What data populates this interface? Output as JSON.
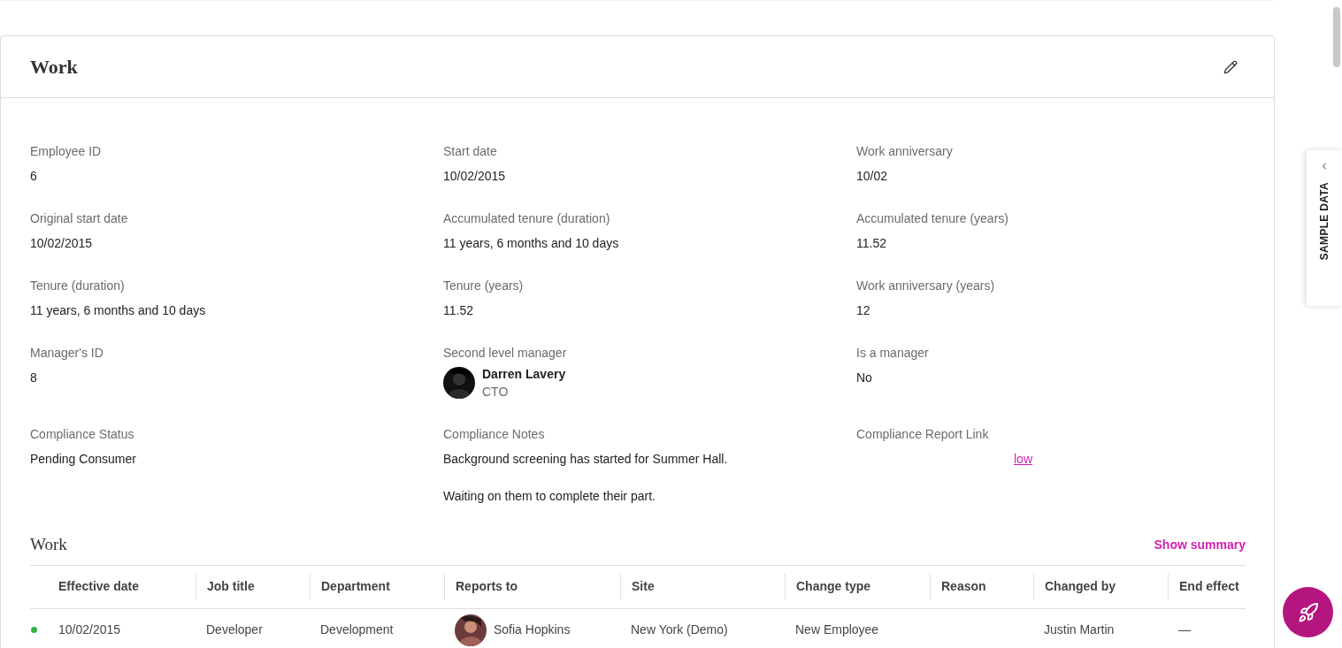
{
  "card": {
    "title": "Work"
  },
  "fields": [
    {
      "kind": "text",
      "label": "Employee ID",
      "value": "6"
    },
    {
      "kind": "text",
      "label": "Start date",
      "value": "10/02/2015"
    },
    {
      "kind": "text",
      "label": "Work anniversary",
      "value": "10/02"
    },
    {
      "kind": "text",
      "label": "Original start date",
      "value": "10/02/2015"
    },
    {
      "kind": "text",
      "label": "Accumulated tenure (duration)",
      "value": "11 years, 6 months and 10 days"
    },
    {
      "kind": "text",
      "label": "Accumulated tenure (years)",
      "value": "11.52"
    },
    {
      "kind": "text",
      "label": "Tenure (duration)",
      "value": "11 years, 6 months and 10 days"
    },
    {
      "kind": "text",
      "label": "Tenure (years)",
      "value": "11.52"
    },
    {
      "kind": "text",
      "label": "Work anniversary (years)",
      "value": "12"
    },
    {
      "kind": "text",
      "label": "Manager's ID",
      "value": "8"
    },
    {
      "kind": "person",
      "label": "Second level manager",
      "name": "Darren Lavery",
      "role": "CTO"
    },
    {
      "kind": "text",
      "label": "Is a manager",
      "value": "No"
    },
    {
      "kind": "text",
      "label": "Compliance Status",
      "value": "Pending Consumer"
    },
    {
      "kind": "notes",
      "label": "Compliance Notes",
      "paragraphs": [
        "Background screening has started for Summer Hall.",
        "Waiting on them to complete their part."
      ]
    },
    {
      "kind": "link",
      "label": "Compliance Report Link",
      "value": "low"
    }
  ],
  "history": {
    "title": "Work",
    "action": "Show summary",
    "columns": [
      "Effective date",
      "Job title",
      "Department",
      "Reports to",
      "Site",
      "Change type",
      "Reason",
      "Changed by",
      "End effect"
    ],
    "rows": [
      {
        "color": "#2fb344",
        "cells": [
          "10/02/2015",
          "Developer",
          "Development",
          "Sofia Hopkins",
          "New York (Demo)",
          "New Employee",
          "",
          "Justin Martin",
          "—"
        ]
      }
    ]
  },
  "side_tab": {
    "label": "SAMPLE DATA"
  }
}
